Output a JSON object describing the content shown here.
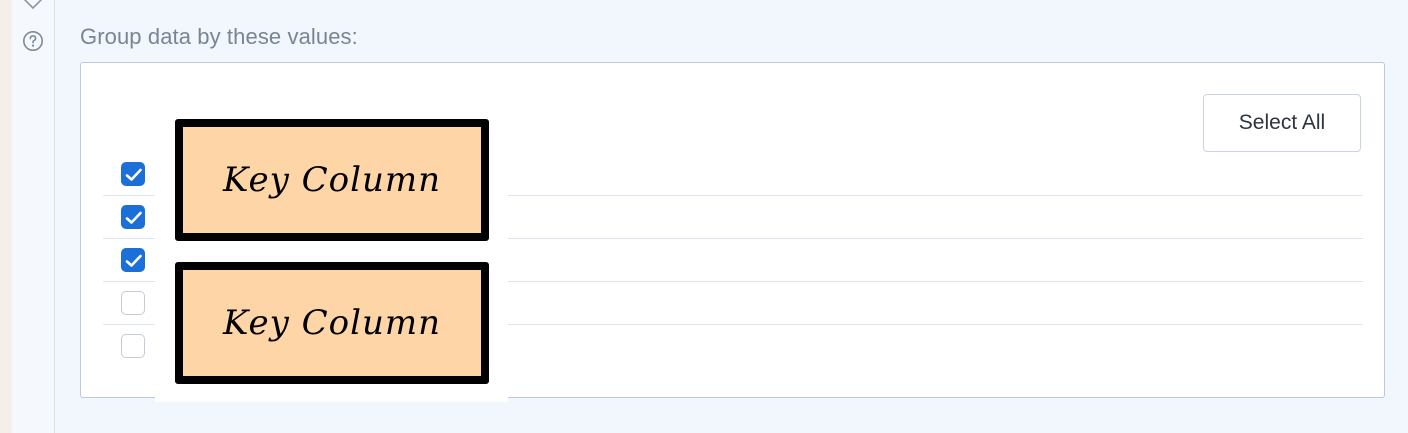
{
  "group": {
    "label": "Group data by these values:",
    "select_all_label": "Select All",
    "options": [
      {
        "checked": true
      },
      {
        "checked": true
      },
      {
        "checked": true
      },
      {
        "checked": false
      },
      {
        "checked": false
      }
    ]
  },
  "overlays": [
    {
      "label": "Key Column"
    },
    {
      "label": "Key Column"
    }
  ],
  "icons": {
    "rail_top": "heart-outline-icon",
    "help": "help-circle-icon",
    "check": "checkmark-icon"
  },
  "colors": {
    "accent": "#1b6fd6",
    "sticker_fill": "#fdd5a6",
    "panel_border": "#b9c9e6",
    "label_text": "#7a8594"
  }
}
